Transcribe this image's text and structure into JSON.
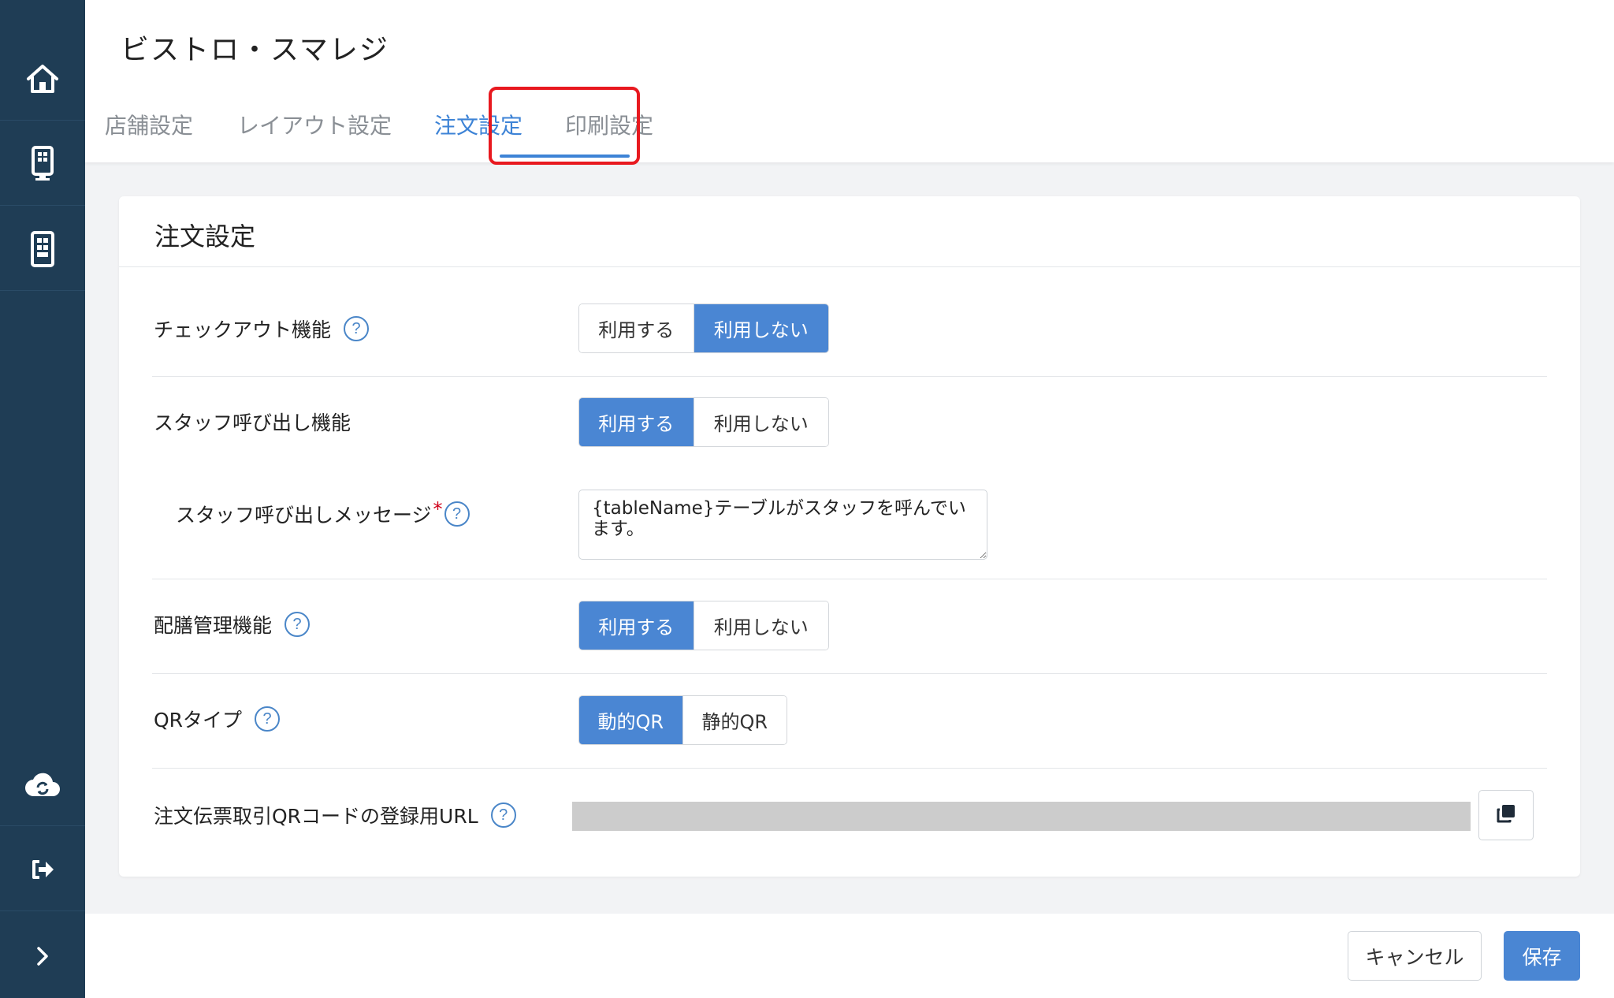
{
  "sidebar": {
    "items": [
      {
        "icon": "home-icon"
      },
      {
        "icon": "kiosk-icon"
      },
      {
        "icon": "tablet-icon"
      },
      {
        "icon": "cloud-sync-icon"
      },
      {
        "icon": "logout-icon"
      },
      {
        "icon": "chevron-right-icon"
      }
    ]
  },
  "header": {
    "store_name": "ビストロ・スマレジ",
    "tabs": [
      {
        "label": "店舗設定"
      },
      {
        "label": "レイアウト設定"
      },
      {
        "label": "注文設定"
      },
      {
        "label": "印刷設定"
      }
    ],
    "active_tab": "注文設定"
  },
  "card": {
    "title": "注文設定",
    "rows": {
      "checkout": {
        "label": "チェックアウト機能",
        "help": "?",
        "options": [
          "利用する",
          "利用しない"
        ],
        "selected": "利用しない"
      },
      "staff_call": {
        "label": "スタッフ呼び出し機能",
        "options": [
          "利用する",
          "利用しない"
        ],
        "selected": "利用する"
      },
      "staff_message": {
        "label": "スタッフ呼び出しメッセージ",
        "required": "*",
        "help": "?",
        "value": "{tableName}テーブルがスタッフを呼んでいます。"
      },
      "serving": {
        "label": "配膳管理機能",
        "help": "?",
        "options": [
          "利用する",
          "利用しない"
        ],
        "selected": "利用する"
      },
      "qr_type": {
        "label": "QRタイプ",
        "help": "?",
        "options": [
          "動的QR",
          "静的QR"
        ],
        "selected": "動的QR"
      },
      "url": {
        "label": "注文伝票取引QRコードの登録用URL",
        "help": "?",
        "copy_icon": "copy-icon"
      }
    }
  },
  "footer": {
    "cancel_label": "キャンセル",
    "save_label": "保存"
  },
  "colors": {
    "sidebar_bg": "#1f3d55",
    "accent": "#4a86d3",
    "highlight": "#e8191f"
  }
}
